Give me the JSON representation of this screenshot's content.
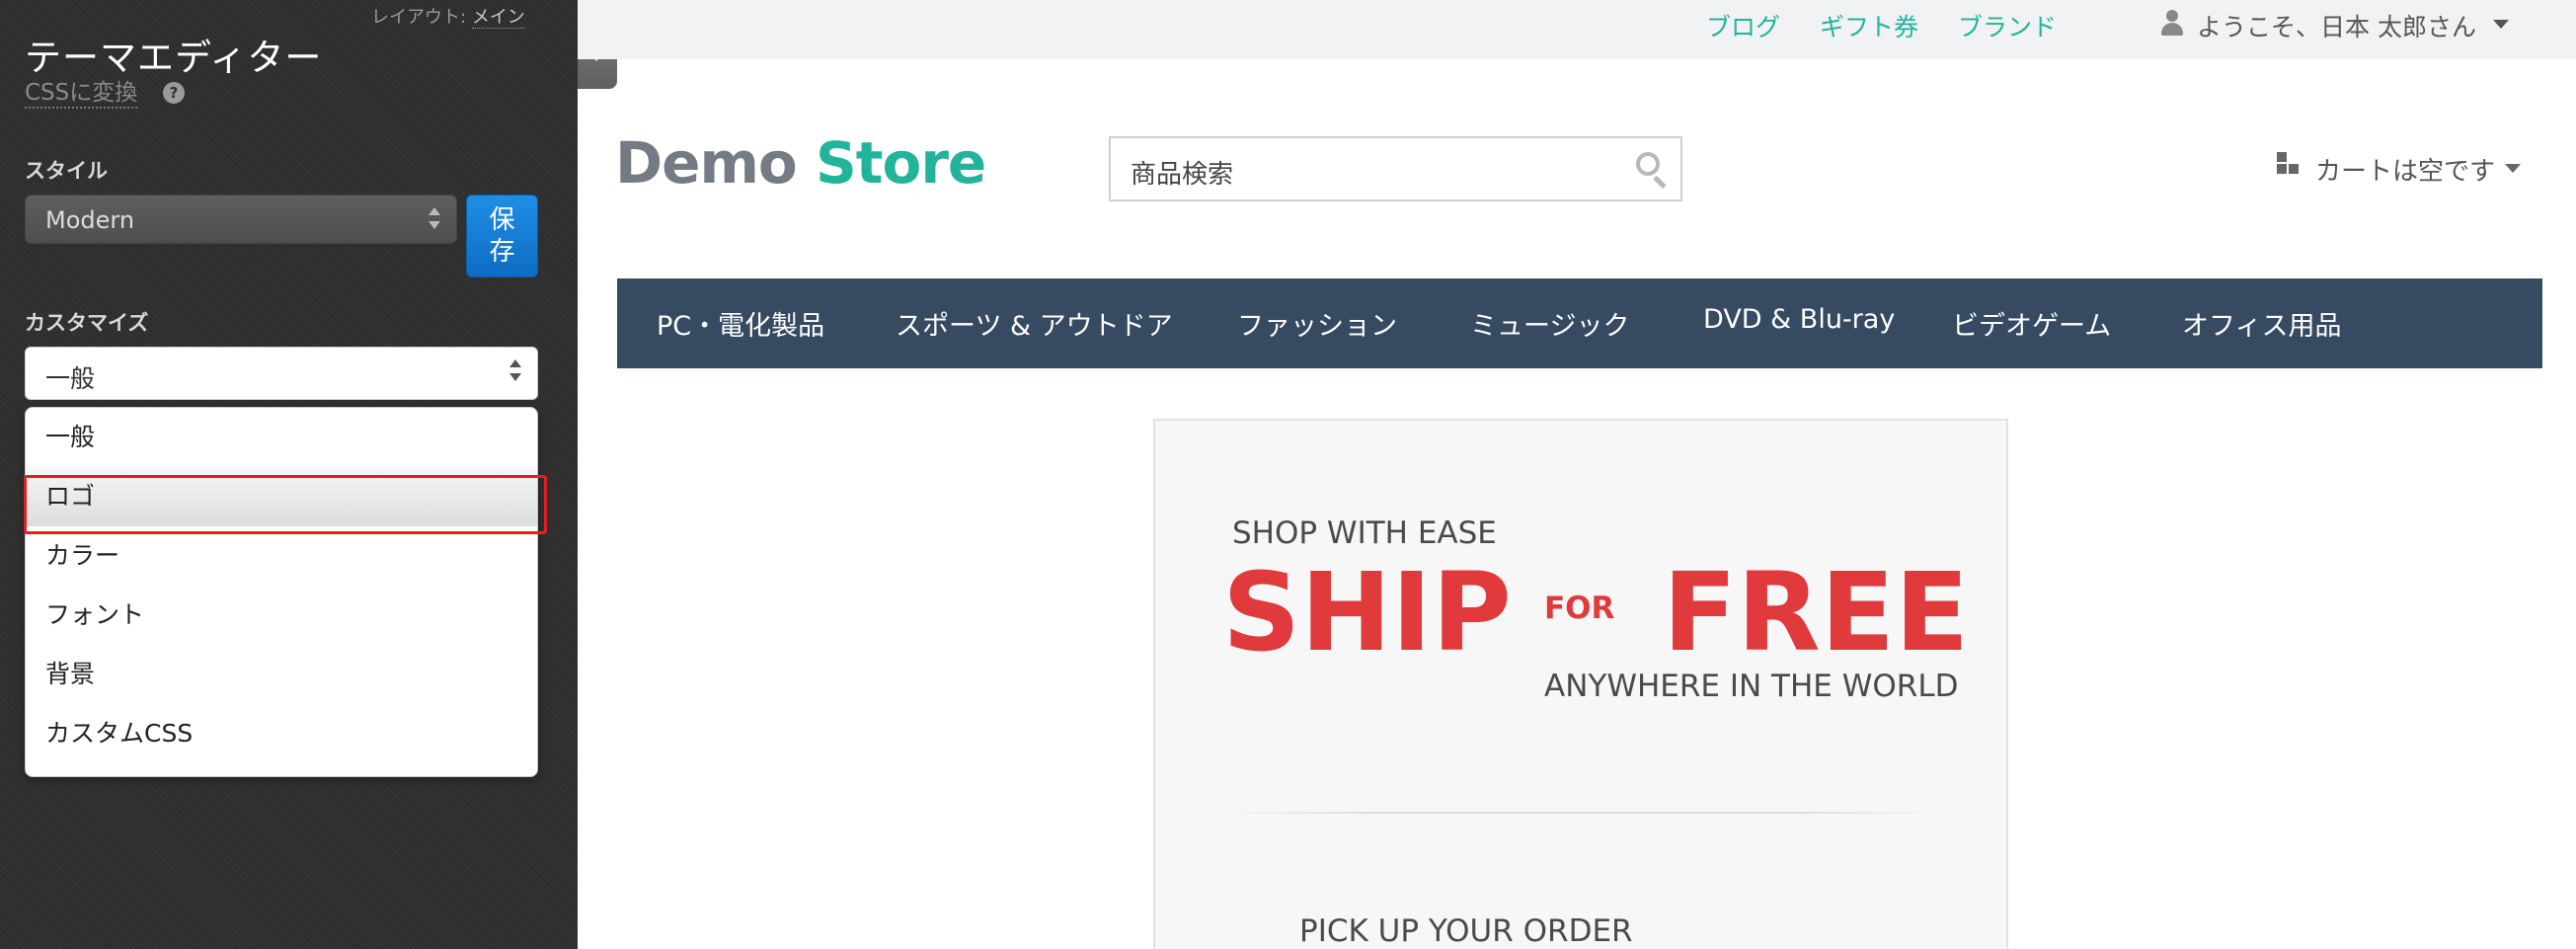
{
  "editor": {
    "layout_label": "レイアウト:",
    "layout_value": "メイン",
    "title": "テーマエディター",
    "convert_link": "CSSに変換",
    "help_glyph": "?",
    "style_label": "スタイル",
    "style_value": "Modern",
    "save_label_line1": "保",
    "save_label_line2": "存",
    "customize_label": "カスタマイズ",
    "customize_value": "一般",
    "customize_options": [
      "一般",
      "ロゴ",
      "カラー",
      "フォント",
      "背景",
      "カスタムCSS"
    ],
    "highlighted_option": "ロゴ",
    "highlight_color": "#e02020"
  },
  "header": {
    "links": [
      "ブログ",
      "ギフト券",
      "ブランド"
    ],
    "user_welcome": "ようこそ、日本 太郎さん",
    "link_color": "#22b49a"
  },
  "store": {
    "logo_demo": "Demo",
    "logo_store": "Store",
    "search_placeholder": "商品検索",
    "cart_text": "カートは空です",
    "nav_items": [
      "PC・電化製品",
      "スポーツ & アウトドア",
      "ファッション",
      "ミュージック",
      "DVD & Blu-ray",
      "ビデオゲーム",
      "オフィス用品"
    ],
    "nav_color": "#364a61"
  },
  "banner": {
    "line1": "SHOP WITH EASE",
    "ship": "SHIP",
    "for": "FOR",
    "free": "FREE",
    "line2": "ANYWHERE IN THE WORLD",
    "line3": "PICK UP YOUR ORDER",
    "accent_color": "#e03a3c"
  }
}
